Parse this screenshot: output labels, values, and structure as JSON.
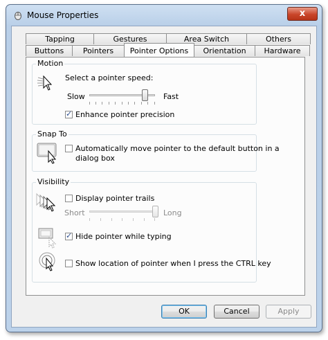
{
  "window": {
    "title": "Mouse Properties",
    "close_label": "x"
  },
  "tabs": {
    "row1": [
      {
        "label": "Tapping",
        "w": 99
      },
      {
        "label": "Gestures",
        "w": 106
      },
      {
        "label": "Area Switch",
        "w": 117
      },
      {
        "label": "Others",
        "w": 93
      }
    ],
    "row2": [
      {
        "label": "Buttons",
        "w": 68
      },
      {
        "label": "Pointers",
        "w": 76
      },
      {
        "label": "Pointer Options",
        "w": 102,
        "active": true
      },
      {
        "label": "Orientation",
        "w": 89
      },
      {
        "label": "Hardware",
        "w": 80
      }
    ]
  },
  "motion": {
    "label": "Motion",
    "prompt": "Select a pointer speed:",
    "slow": "Slow",
    "fast": "Fast",
    "speed_fraction": 0.85,
    "enhance_label": "Enhance pointer precision",
    "enhance_checked": true
  },
  "snap": {
    "label": "Snap To",
    "line1": "Automatically move pointer to the default button in a",
    "line2": "dialog box",
    "checked": false
  },
  "visibility": {
    "label": "Visibility",
    "trails_label": "Display pointer trails",
    "trails_checked": false,
    "short": "Short",
    "long": "Long",
    "trail_fraction": 1.0,
    "hide_label": "Hide pointer while typing",
    "hide_checked": true,
    "ctrl_label": "Show location of pointer when I press the CTRL key",
    "ctrl_checked": false
  },
  "buttons": {
    "ok": "OK",
    "cancel": "Cancel",
    "apply": "Apply"
  },
  "check_glyph": "✓"
}
